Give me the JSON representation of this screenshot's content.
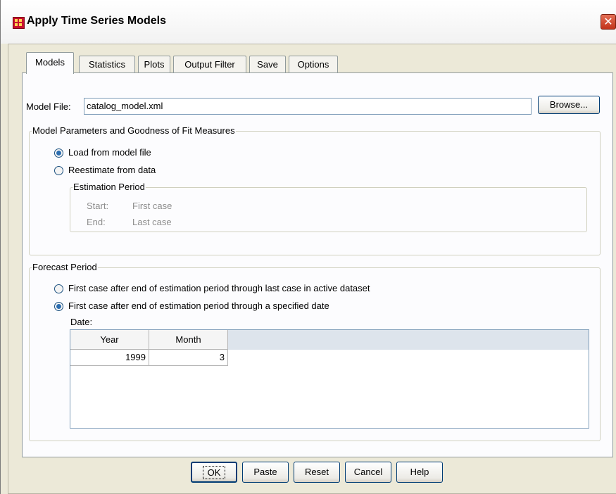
{
  "window": {
    "title": "Apply Time Series Models",
    "close_glyph": "✕"
  },
  "tabs": [
    {
      "label": "Models",
      "active": true
    },
    {
      "label": "Statistics"
    },
    {
      "label": "Plots"
    },
    {
      "label": "Output Filter"
    },
    {
      "label": "Save"
    },
    {
      "label": "Options"
    }
  ],
  "model_file": {
    "label": "Model File:",
    "value": "catalog_model.xml",
    "browse_label": "Browse..."
  },
  "params_group": {
    "title": "Model Parameters and Goodness of Fit Measures",
    "load_option": "Load from model file",
    "reestimate_option": "Reestimate from data",
    "selected": "load",
    "estimation_period": {
      "title": "Estimation Period",
      "start_label": "Start:",
      "start_value": "First case",
      "end_label": "End:",
      "end_value": "Last case"
    }
  },
  "forecast_group": {
    "title": "Forecast Period",
    "option_active": "First case after end of estimation period through last case in active dataset",
    "option_date": "First case after end of estimation period through a specified date",
    "selected": "date",
    "date_label": "Date:",
    "columns": [
      "Year",
      "Month"
    ],
    "rows": [
      [
        "1999",
        "3"
      ]
    ]
  },
  "buttons": {
    "ok": "OK",
    "paste": "Paste",
    "reset": "Reset",
    "cancel": "Cancel",
    "help": "Help"
  },
  "colors": {
    "dialog_bg": "#ece9d8",
    "tab_page_bg": "#fcfcfe",
    "radio_dot": "#2b6db0",
    "close_button": "#c2321a"
  }
}
